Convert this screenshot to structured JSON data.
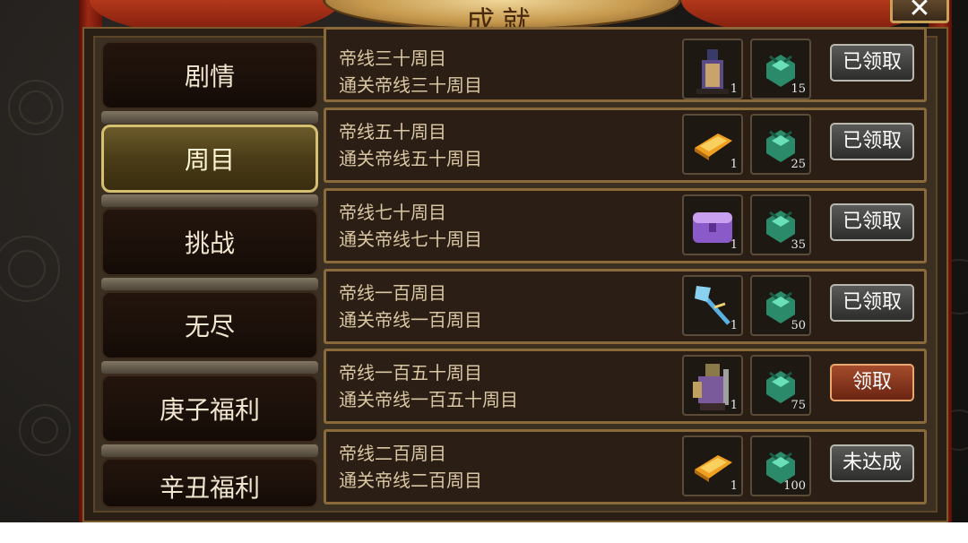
{
  "window": {
    "title": "成就",
    "close_label": "✕"
  },
  "tabs": [
    {
      "label": "剧情",
      "active": false
    },
    {
      "label": "周目",
      "active": true
    },
    {
      "label": "挑战",
      "active": false
    },
    {
      "label": "无尽",
      "active": false
    },
    {
      "label": "庚子福利",
      "active": false
    },
    {
      "label": "辛丑福利",
      "active": false
    }
  ],
  "achievements": [
    {
      "title": "帝线三十周目",
      "desc": "通关帝线三十周目",
      "reward1_icon": "general-portrait-icon",
      "reward1_qty": "1",
      "reward2_icon": "jade-gift-icon",
      "reward2_qty": "15",
      "button": "已领取",
      "state": "claimed"
    },
    {
      "title": "帝线五十周目",
      "desc": "通关帝线五十周目",
      "reward1_icon": "gold-book-icon",
      "reward1_qty": "1",
      "reward2_icon": "jade-gift-icon",
      "reward2_qty": "25",
      "button": "已领取",
      "state": "claimed"
    },
    {
      "title": "帝线七十周目",
      "desc": "通关帝线七十周目",
      "reward1_icon": "purple-chest-icon",
      "reward1_qty": "1",
      "reward2_icon": "jade-gift-icon",
      "reward2_qty": "35",
      "button": "已领取",
      "state": "claimed"
    },
    {
      "title": "帝线一百周目",
      "desc": "通关帝线一百周目",
      "reward1_icon": "ice-axe-icon",
      "reward1_qty": "1",
      "reward2_icon": "jade-gift-icon",
      "reward2_qty": "50",
      "button": "已领取",
      "state": "claimed"
    },
    {
      "title": "帝线一百五十周目",
      "desc": "通关帝线一百五十周目",
      "reward1_icon": "armored-general-icon",
      "reward1_qty": "1",
      "reward2_icon": "jade-gift-icon",
      "reward2_qty": "75",
      "button": "领取",
      "state": "claimable"
    },
    {
      "title": "帝线二百周目",
      "desc": "通关帝线二百周目",
      "reward1_icon": "gold-book-icon",
      "reward1_qty": "1",
      "reward2_icon": "jade-gift-icon",
      "reward2_qty": "100",
      "button": "未达成",
      "state": "locked"
    }
  ],
  "colors": {
    "panel": "#3b2f22",
    "row_border": "#8a6a3a",
    "claim_button": "#a54c2c",
    "active_tab_border": "#d4c070"
  }
}
